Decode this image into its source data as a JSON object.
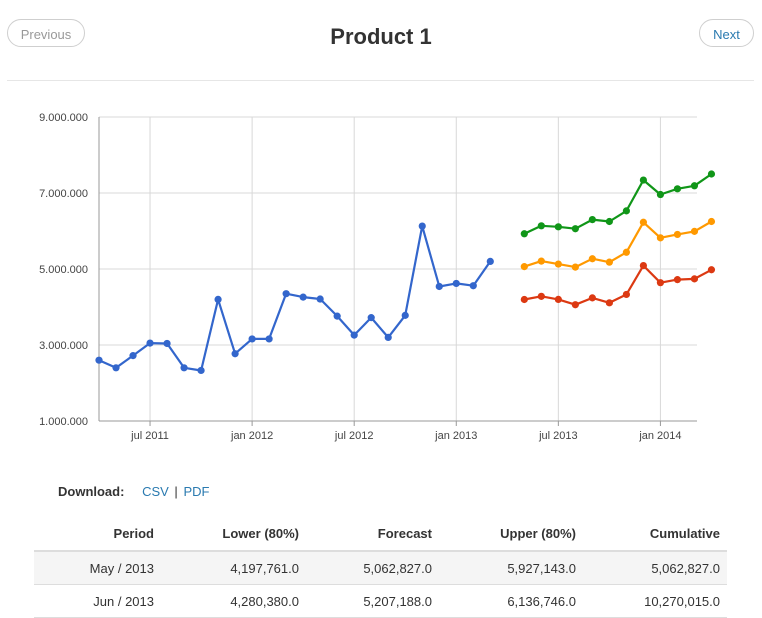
{
  "header": {
    "title": "Product 1",
    "prev_label": "Previous",
    "next_label": "Next"
  },
  "download": {
    "label": "Download:",
    "csv_label": "CSV",
    "separator": "|",
    "pdf_label": "PDF"
  },
  "chart_data": {
    "type": "line",
    "title": "",
    "y_ticks": [
      "1.000.000",
      "3.000.000",
      "5.000.000",
      "7.000.000",
      "9.000.000"
    ],
    "ylim": [
      1000000,
      9000000
    ],
    "x_ticks": [
      {
        "label": "jul 2011",
        "date": "2011-07-01"
      },
      {
        "label": "jan 2012",
        "date": "2012-01-01"
      },
      {
        "label": "jul 2012",
        "date": "2012-07-01"
      },
      {
        "label": "jan 2013",
        "date": "2013-01-01"
      },
      {
        "label": "jul 2013",
        "date": "2013-07-01"
      },
      {
        "label": "jan 2014",
        "date": "2014-01-01"
      }
    ],
    "xlim": [
      "2011-04-01",
      "2014-03-01"
    ],
    "grid": true,
    "series": [
      {
        "color": "#3366cc",
        "x": [
          "2011-04-01",
          "2011-05-01",
          "2011-06-01",
          "2011-07-01",
          "2011-08-01",
          "2011-09-01",
          "2011-10-01",
          "2011-11-01",
          "2011-12-01",
          "2012-01-01",
          "2012-02-01",
          "2012-03-01",
          "2012-04-01",
          "2012-05-01",
          "2012-06-01",
          "2012-07-01",
          "2012-08-01",
          "2012-09-01",
          "2012-10-01",
          "2012-11-01",
          "2012-12-01",
          "2013-01-01",
          "2013-02-01",
          "2013-03-01",
          "2013-04-01"
        ],
        "y": [
          2600000,
          2400000,
          2720000,
          3050000,
          3040000,
          2400000,
          2330000,
          4200000,
          2770000,
          3160000,
          3160000,
          4350000,
          4260000,
          4210000,
          3760000,
          3260000,
          3720000,
          3200000,
          3780000,
          6130000,
          4540000,
          4620000,
          4560000,
          5200000,
          null
        ]
      },
      {
        "color": "#109618",
        "x": [
          "2013-05-01",
          "2013-06-01",
          "2013-07-01",
          "2013-08-01",
          "2013-09-01",
          "2013-10-01",
          "2013-11-01",
          "2013-12-01",
          "2014-01-01",
          "2014-02-01",
          "2014-03-01"
        ],
        "y": [
          5927143,
          6136746,
          6110000,
          6060000,
          6300000,
          6250000,
          6530000,
          7340000,
          6960000,
          7110000,
          7190000
        ]
      },
      {
        "color": "#ff9900",
        "x": [
          "2013-05-01",
          "2013-06-01",
          "2013-07-01",
          "2013-08-01",
          "2013-09-01",
          "2013-10-01",
          "2013-11-01",
          "2013-12-01",
          "2014-01-01",
          "2014-02-01",
          "2014-03-01"
        ],
        "y": [
          5062827,
          5207188,
          5130000,
          5050000,
          5270000,
          5180000,
          5440000,
          6230000,
          5820000,
          5910000,
          5990000
        ]
      },
      {
        "color": "#dc3912",
        "x": [
          "2013-05-01",
          "2013-06-01",
          "2013-07-01",
          "2013-08-01",
          "2013-09-01",
          "2013-10-01",
          "2013-11-01",
          "2013-12-01",
          "2014-01-01",
          "2014-02-01",
          "2014-03-01"
        ],
        "y": [
          4197761,
          4280380,
          4200000,
          4060000,
          4240000,
          4110000,
          4330000,
          5090000,
          4640000,
          4720000,
          4740000
        ]
      }
    ],
    "series_tail": [
      {
        "index": 1,
        "x": "2014-04-01",
        "y": 7500000
      },
      {
        "index": 2,
        "x": "2014-04-01",
        "y": 6250000
      },
      {
        "index": 3,
        "x": "2014-04-01",
        "y": 4980000
      }
    ]
  },
  "table": {
    "columns": [
      "Period",
      "Lower (80%)",
      "Forecast",
      "Upper (80%)",
      "Cumulative"
    ],
    "rows": [
      [
        "May / 2013",
        "4,197,761.0",
        "5,062,827.0",
        "5,927,143.0",
        "5,062,827.0"
      ],
      [
        "Jun / 2013",
        "4,280,380.0",
        "5,207,188.0",
        "6,136,746.0",
        "10,270,015.0"
      ]
    ]
  }
}
